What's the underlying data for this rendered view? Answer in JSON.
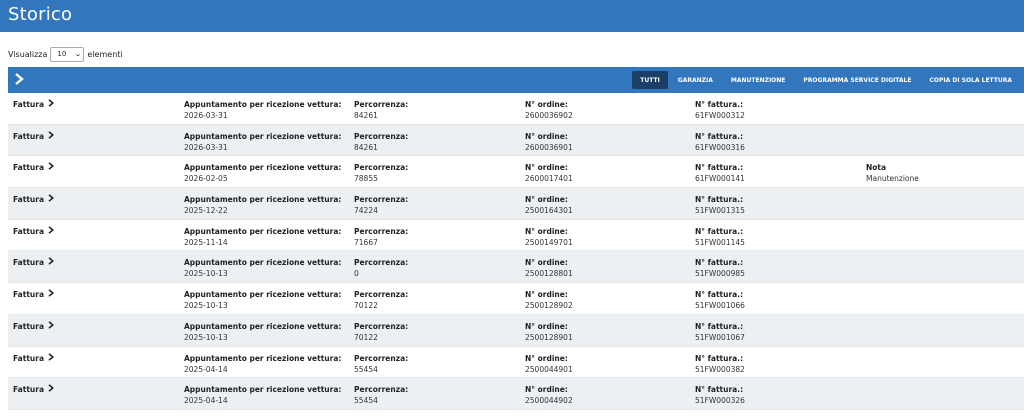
{
  "header": {
    "title": "Storico"
  },
  "length": {
    "prefix": "Visualizza",
    "value": "10",
    "suffix": "elementi"
  },
  "toolbar": {
    "toggle_icon": "chevron-right-icon",
    "tabs": [
      {
        "label": "TUTTI",
        "active": true
      },
      {
        "label": "GARANZIA",
        "active": false
      },
      {
        "label": "MANUTENZIONE",
        "active": false
      },
      {
        "label": "PROGRAMMA SERVICE DIGITALE",
        "active": false
      },
      {
        "label": "COPIA DI SOLA LETTURA",
        "active": false
      }
    ]
  },
  "labels": {
    "invoice": "Fattura",
    "appointment": "Appuntamento per ricezione vettura:",
    "mileage": "Percorrenza:",
    "order": "N° ordine:",
    "invoice_no": "N° fattura.:"
  },
  "rows": [
    {
      "date": "2026-03-31",
      "km": "84261",
      "order": "2600036902",
      "invoice": "61FW000312",
      "note_label": "",
      "note_value": ""
    },
    {
      "date": "2026-03-31",
      "km": "84261",
      "order": "2600036901",
      "invoice": "61FW000316",
      "note_label": "",
      "note_value": ""
    },
    {
      "date": "2026-02-05",
      "km": "78855",
      "order": "2600017401",
      "invoice": "61FW000141",
      "note_label": "Nota",
      "note_value": "Manutenzione"
    },
    {
      "date": "2025-12-22",
      "km": "74224",
      "order": "2500164301",
      "invoice": "51FW001315",
      "note_label": "",
      "note_value": ""
    },
    {
      "date": "2025-11-14",
      "km": "71667",
      "order": "2500149701",
      "invoice": "51FW001145",
      "note_label": "",
      "note_value": ""
    },
    {
      "date": "2025-10-13",
      "km": "0",
      "order": "2500128801",
      "invoice": "51FW000985",
      "note_label": "",
      "note_value": ""
    },
    {
      "date": "2025-10-13",
      "km": "70122",
      "order": "2500128902",
      "invoice": "51FW001066",
      "note_label": "",
      "note_value": ""
    },
    {
      "date": "2025-10-13",
      "km": "70122",
      "order": "2500128901",
      "invoice": "51FW001067",
      "note_label": "",
      "note_value": ""
    },
    {
      "date": "2025-04-14",
      "km": "55454",
      "order": "2500044901",
      "invoice": "51FW000382",
      "note_label": "",
      "note_value": ""
    },
    {
      "date": "2025-04-14",
      "km": "55454",
      "order": "2500044902",
      "invoice": "51FW000326",
      "note_label": "",
      "note_value": ""
    }
  ]
}
